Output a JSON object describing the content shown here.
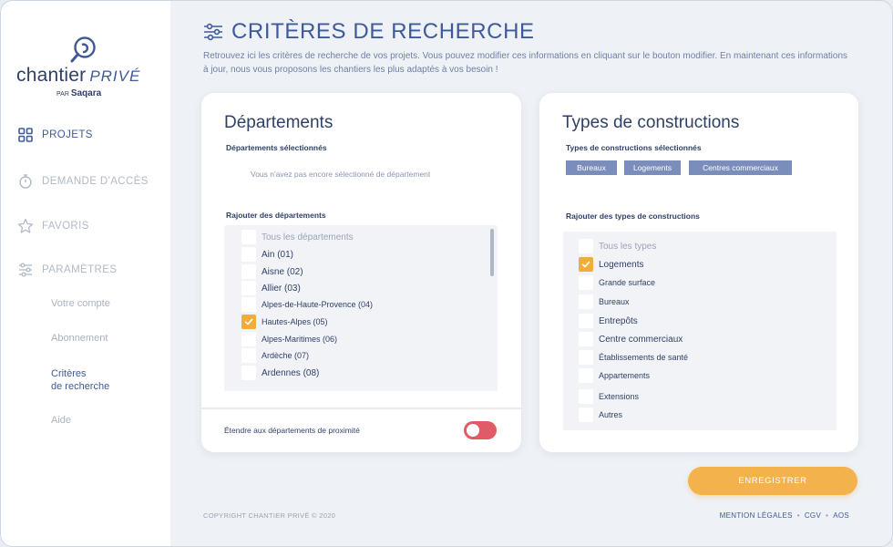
{
  "brand": {
    "name": "chantier",
    "name_accent": "PRIVÉ",
    "by_prefix": "PAR",
    "by_brand": "Saqara"
  },
  "sidebar": {
    "items": [
      {
        "label": "PROJETS",
        "icon": "grid-icon",
        "state": "active"
      },
      {
        "label": "DEMANDE D'ACCÈS",
        "icon": "timer-icon",
        "state": "muted"
      },
      {
        "label": "FAVORIS",
        "icon": "star-icon",
        "state": "muted"
      },
      {
        "label": "PARAMÈTRES",
        "icon": "sliders-icon",
        "state": "muted"
      }
    ],
    "subitems": [
      {
        "label": "Votre compte"
      },
      {
        "label": "Abonnement"
      },
      {
        "label_line1": "Critères",
        "label_line2": "de recherche",
        "state": "active"
      },
      {
        "label": "Aide"
      }
    ]
  },
  "header": {
    "icon": "sliders-icon",
    "title": "CRITÈRES DE RECHERCHE",
    "intro": "Retrouvez ici les critères de recherche de vos projets. Vous pouvez modifier ces informations en cliquant sur le bouton modifier. En maintenant ces informations à jour, nous vous proposons les chantiers les plus adaptés à vos besoin !"
  },
  "departements": {
    "title": "Départements",
    "selected_label": "Départements sélectionnés",
    "empty_message": "Vous n'avez pas encore sélectionné de département",
    "add_label": "Rajouter des départements",
    "options": [
      {
        "label": "Tous les départements",
        "checked": false,
        "dim": true
      },
      {
        "label": "Ain (01)",
        "checked": false
      },
      {
        "label": "Aisne (02)",
        "checked": false
      },
      {
        "label": "Allier (03)",
        "checked": false
      },
      {
        "label": "Alpes-de-Haute-Provence (04)",
        "checked": false
      },
      {
        "label": "Hautes-Alpes (05)",
        "checked": true
      },
      {
        "label": "Alpes-Maritimes (06)",
        "checked": false
      },
      {
        "label": "Ardèche (07)",
        "checked": false
      },
      {
        "label": "Ardennes (08)",
        "checked": false
      }
    ],
    "proximity_label": "Étendre aux départements de proximité",
    "proximity_enabled": false
  },
  "constructions": {
    "title": "Types de constructions",
    "selected_label": "Types de constructions sélectionnés",
    "selected_tags": [
      "Bureaux",
      "Logements",
      "Centres commerciaux"
    ],
    "add_label": "Rajouter des types de constructions",
    "options": [
      {
        "label": "Tous les types",
        "checked": false,
        "dim": true
      },
      {
        "label": "Logements",
        "checked": true
      },
      {
        "label": "Grande surface",
        "checked": false
      },
      {
        "label": "Bureaux",
        "checked": false
      },
      {
        "label": "Entrepôts",
        "checked": false
      },
      {
        "label": "Centre commerciaux",
        "checked": false
      },
      {
        "label": "Établissements de santé",
        "checked": false
      },
      {
        "label": "Appartements",
        "checked": false
      },
      {
        "label": "Extensions",
        "checked": false
      },
      {
        "label": "Autres",
        "checked": false
      }
    ]
  },
  "actions": {
    "save_label": "ENREGISTRER"
  },
  "footer": {
    "copyright": "COPYRIGHT CHANTIER PRIVÉ © 2020",
    "links": [
      "MENTION LÉGALES",
      "CGV",
      "AOS"
    ],
    "separator": "•"
  },
  "colors": {
    "primary": "#3f5a98",
    "accent": "#f0ad3c",
    "toggle_off": "#e05a68",
    "tag": "#7b8dbb"
  }
}
